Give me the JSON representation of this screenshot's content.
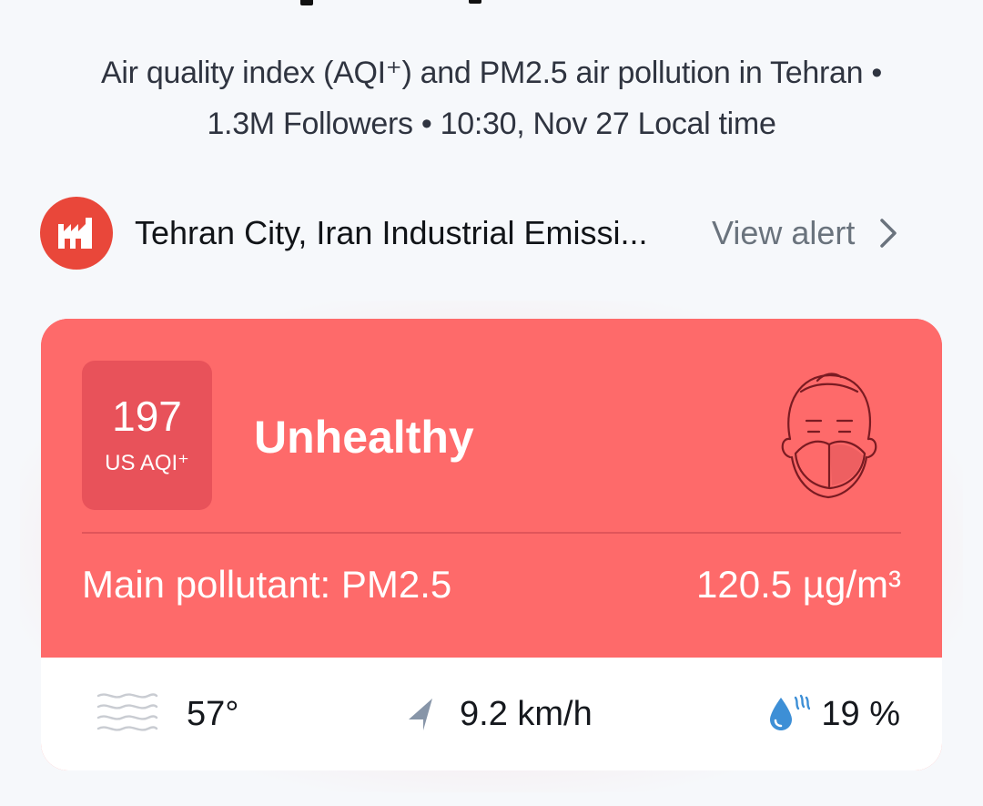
{
  "header": {
    "subtitle_line1": "Air quality index (AQI⁺) and PM2.5 air pollution in Tehran •",
    "subtitle_line2": "1.3M Followers • 10:30, Nov 27 Local time"
  },
  "alert": {
    "icon": "industry-icon",
    "text": "Tehran City, Iran Industrial Emissi...",
    "action_label": "View alert",
    "chevron_icon": "chevron-right-icon",
    "color": "#e9473a"
  },
  "aqi_card": {
    "aqi_value": "197",
    "aqi_unit": "US AQI⁺",
    "status": "Unhealthy",
    "status_icon": "face-mask-icon",
    "pollutant_label": "Main pollutant: PM2.5",
    "concentration": "120.5 µg/m³",
    "color": "#fe6a6a",
    "badge_color": "#e8525a"
  },
  "weather": {
    "temperature": "57°",
    "temperature_icon": "haze-icon",
    "wind_speed": "9.2 km/h",
    "wind_icon": "wind-direction-icon",
    "humidity": "19 %",
    "humidity_icon": "humidity-drop-icon"
  }
}
